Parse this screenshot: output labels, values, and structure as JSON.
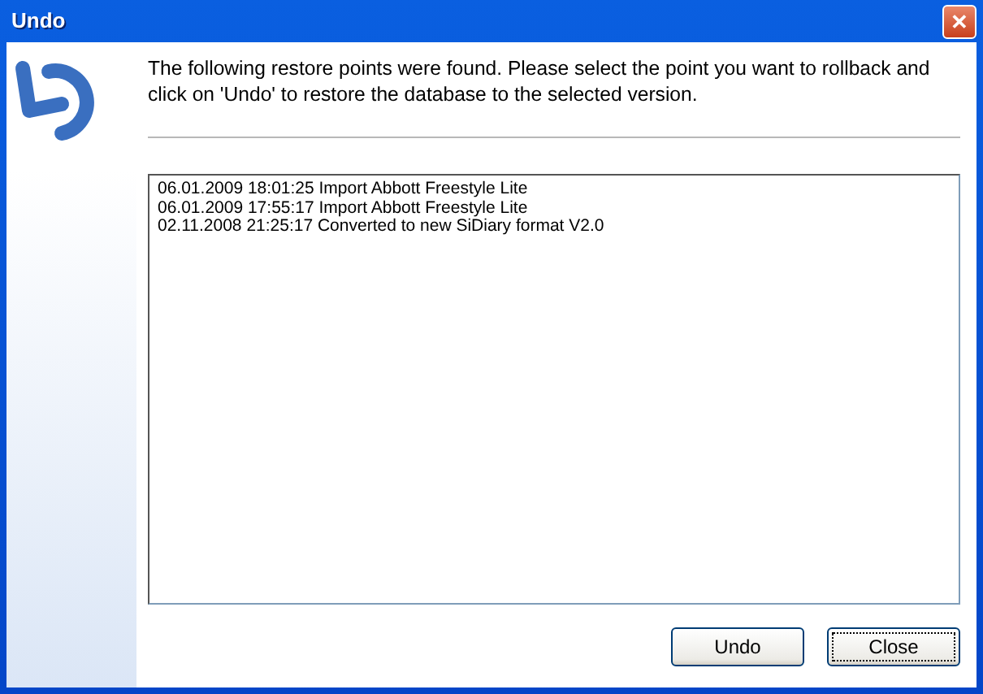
{
  "window": {
    "title": "Undo",
    "close_glyph": "✕"
  },
  "message": "The following restore points were found. Please select the point you want to rollback and click on 'Undo' to restore the database to the selected version.",
  "restore_points": [
    {
      "text": "06.01.2009 18:01:25 Import Abbott Freestyle Lite"
    },
    {
      "text": "06.01.2009 17:55:17 Import Abbott Freestyle Lite"
    },
    {
      "text": "02.11.2008 21:25:17 Converted to new SiDiary format V2.0"
    }
  ],
  "buttons": [
    {
      "label": "Undo",
      "focused": false
    },
    {
      "label": "Close",
      "focused": true
    }
  ]
}
